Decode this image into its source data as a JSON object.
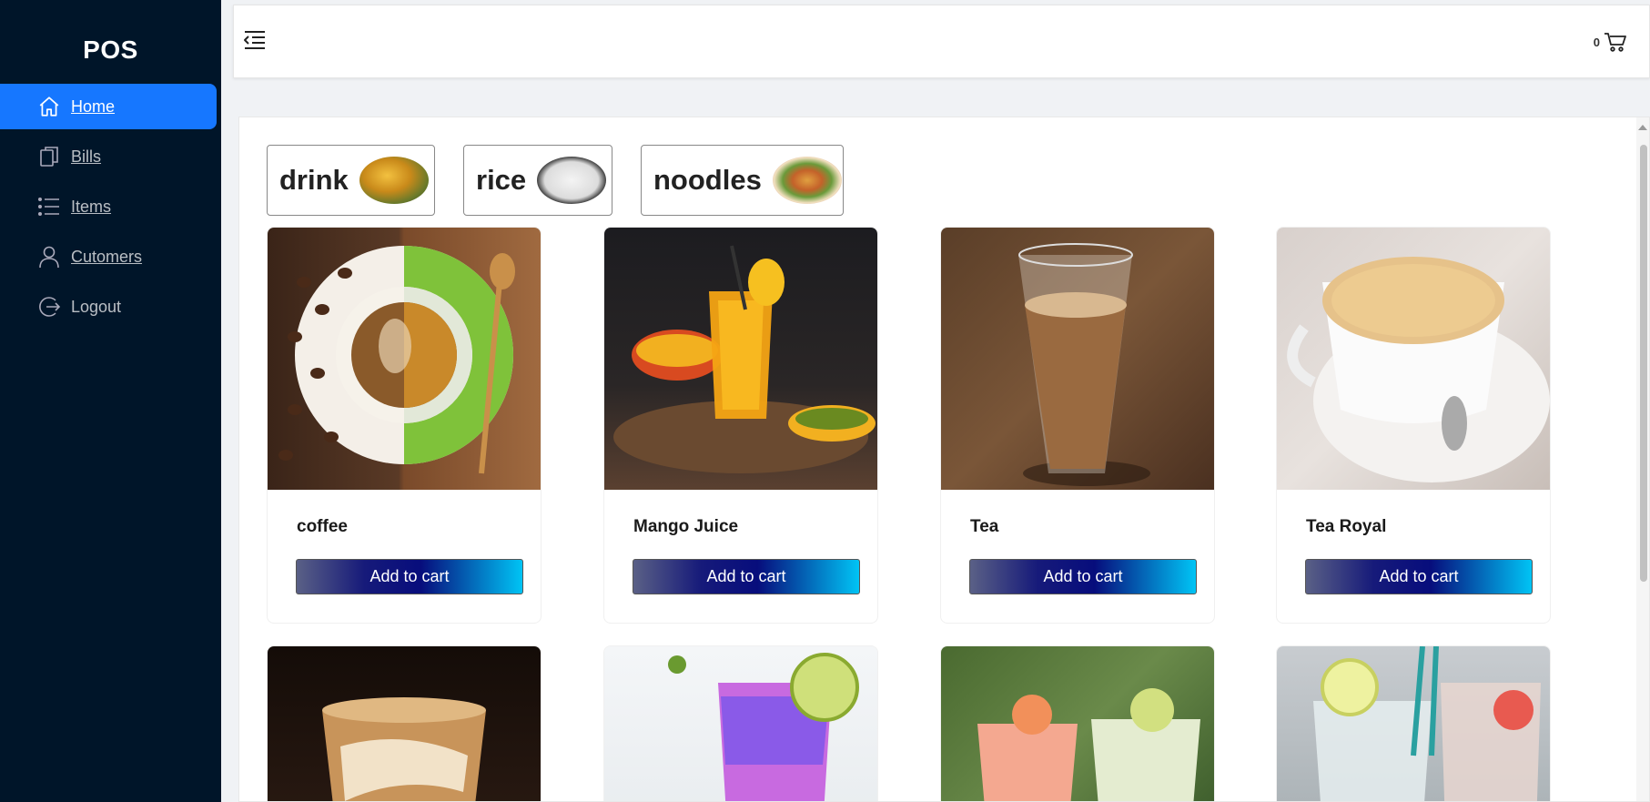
{
  "app": {
    "logo": "POS"
  },
  "sidebar": {
    "items": [
      {
        "label": "Home",
        "icon": "home-icon",
        "active": true
      },
      {
        "label": "Bills",
        "icon": "copy-icon",
        "active": false
      },
      {
        "label": "Items",
        "icon": "list-icon",
        "active": false
      },
      {
        "label": "Cutomers",
        "icon": "user-icon",
        "active": false
      },
      {
        "label": "Logout",
        "icon": "logout-icon",
        "active": false
      }
    ]
  },
  "header": {
    "cart_count": "0",
    "collapse_icon": "menu-fold-icon",
    "cart_icon": "shopping-cart-icon"
  },
  "categories": [
    {
      "label": "drink",
      "image": "drink-image"
    },
    {
      "label": "rice",
      "image": "rice-image"
    },
    {
      "label": "noodles",
      "image": "noodles-image"
    }
  ],
  "products": [
    {
      "name": "coffee",
      "button": "Add to cart",
      "image": "coffee-image"
    },
    {
      "name": "Mango Juice",
      "button": "Add to cart",
      "image": "mango-juice-image"
    },
    {
      "name": "Tea",
      "button": "Add to cart",
      "image": "tea-image"
    },
    {
      "name": "Tea Royal",
      "button": "Add to cart",
      "image": "tea-royal-image"
    },
    {
      "name": "",
      "button": "",
      "image": "iced-coffee-image"
    },
    {
      "name": "",
      "button": "",
      "image": "purple-drink-image"
    },
    {
      "name": "",
      "button": "",
      "image": "cocktails-image"
    },
    {
      "name": "",
      "button": "",
      "image": "infused-water-image"
    }
  ],
  "theme": {
    "sidebar_bg": "#001529",
    "active_item": "#1677ff",
    "button_gradient_start": "#5a6086",
    "button_gradient_end": "#00c4f5"
  }
}
